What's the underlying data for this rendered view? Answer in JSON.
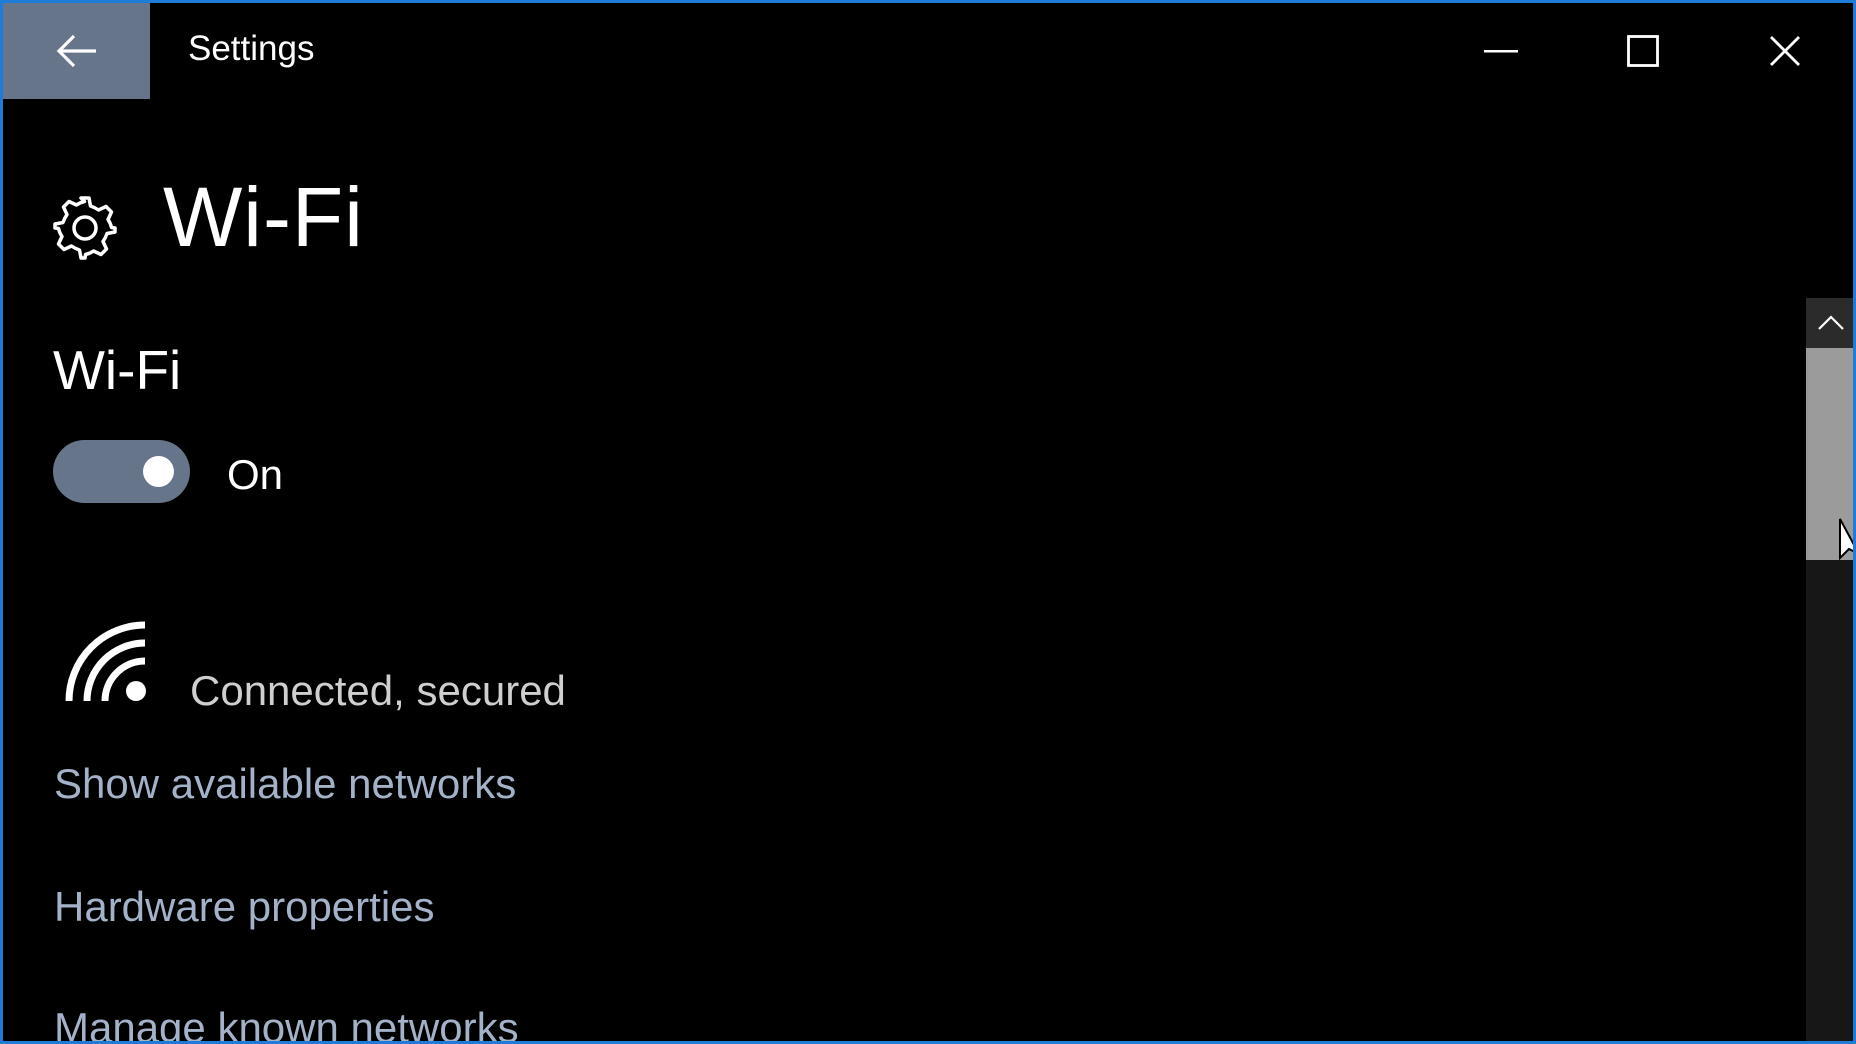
{
  "window": {
    "title": "Settings",
    "border_color": "#1e7bd8"
  },
  "titlebar": {
    "back_icon": "back-arrow-icon",
    "minimize_icon": "minimize-icon",
    "maximize_icon": "maximize-icon",
    "close_icon": "close-icon"
  },
  "page": {
    "icon": "gear-icon",
    "title": "Wi-Fi"
  },
  "wifi": {
    "heading": "Wi-Fi",
    "toggle_state": "On",
    "toggle_on": true,
    "status_icon": "wifi-signal-icon",
    "status_text": "Connected, secured"
  },
  "links": {
    "show_networks": "Show available networks",
    "hardware_properties": "Hardware properties",
    "manage_networks": "Manage known networks"
  },
  "scrollbar": {
    "up_icon": "chevron-up-icon"
  },
  "colors": {
    "accent": "#67758a",
    "link": "#a3b2c8",
    "background": "#000000"
  }
}
